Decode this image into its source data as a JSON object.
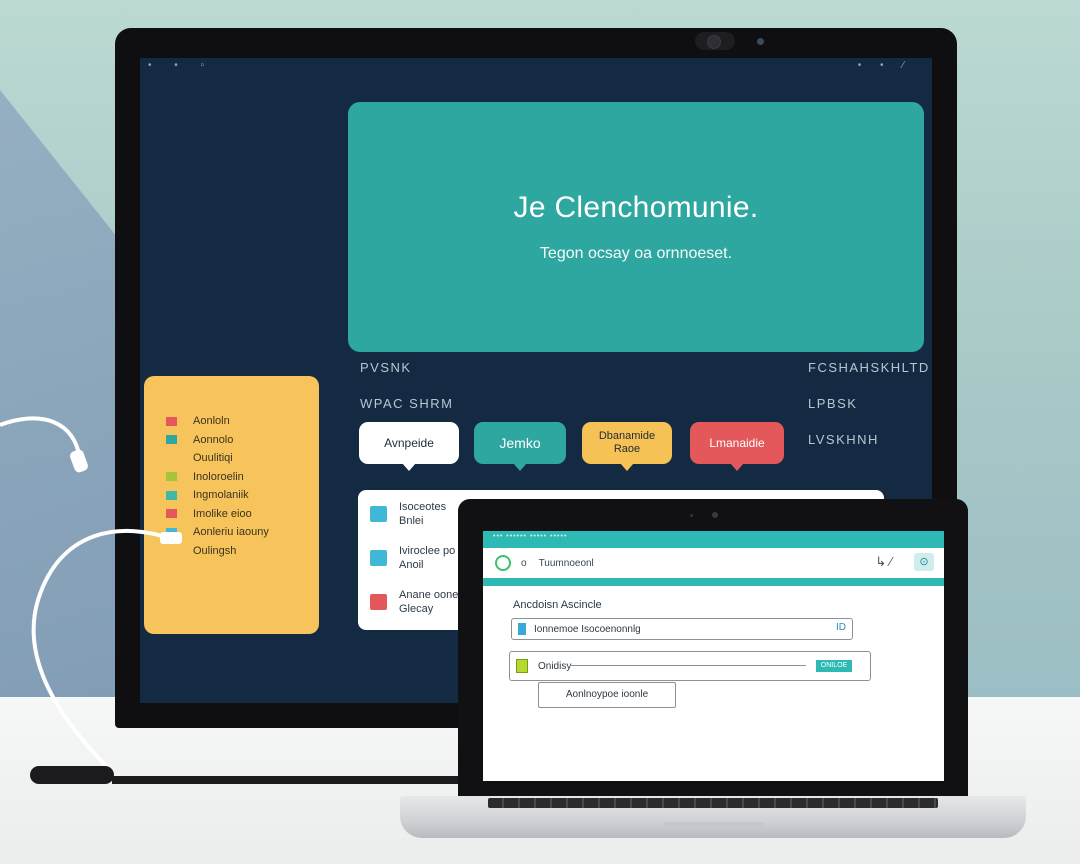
{
  "monitor": {
    "hero_title": "Je Clenchomunie.",
    "hero_subtitle": "Tegon ocsay oa ornnoeset.",
    "labels_left": [
      "PVSNK",
      "WPAC SHRM"
    ],
    "labels_right": [
      "FCSHAHSKHLTD",
      "LPBSK",
      "LVSKHNH"
    ],
    "bubbles": [
      {
        "label": "Avnpeide",
        "color": "#ffffff"
      },
      {
        "label": "Jemko",
        "color": "#2fa7a1"
      },
      {
        "label": "Dbanamide Raoe",
        "color": "#f6c155"
      },
      {
        "label": "Lmanaidie",
        "color": "#e4575a"
      }
    ],
    "card_rows": [
      {
        "text": "Isoceotes\nBnlei",
        "color": "#3fb8d6"
      },
      {
        "text": "Iviroclee po\nAnoil",
        "color": "#3fb8d6"
      },
      {
        "text": "Anane ooneni\nGlecay",
        "color": "#e4575a"
      }
    ],
    "card_action": "+"
  },
  "yellow_panel": {
    "items": [
      {
        "label": "Aonloln",
        "color": "#e4575a"
      },
      {
        "label": "Aonnolo",
        "color": "#2fa7a1"
      },
      {
        "label": "Ouulitiqi",
        "color": ""
      },
      {
        "label": "Inoloroelin",
        "color": "#a6c43a"
      },
      {
        "label": "Ingmolaniik",
        "color": "#3fb8a8"
      },
      {
        "label": "Imolike eioo",
        "color": "#e4575a"
      },
      {
        "label": "Aonleriu iaouny",
        "color": "#3fb8d6"
      },
      {
        "label": "Oulingsh",
        "color": ""
      }
    ]
  },
  "laptop": {
    "top_bar_text": "••• •••••• ••••• •••••",
    "title": "Tuumnoeonl",
    "section_label": "Ancdoisn Ascincle",
    "field1_text": "Ionnemoe Isocoenonnlg",
    "field1_end": "ID",
    "field2_text": "Onidisy",
    "field2_chip": "ONILOE",
    "button_label": "Aonlnoypoe ioonle",
    "edit_glyph": "↳ ⁄",
    "side_button": "⊙"
  },
  "colors": {
    "screen_bg": "#132a42",
    "accent_teal": "#2fa7a1",
    "accent_yellow": "#f7c35b",
    "accent_red": "#e4575a"
  }
}
